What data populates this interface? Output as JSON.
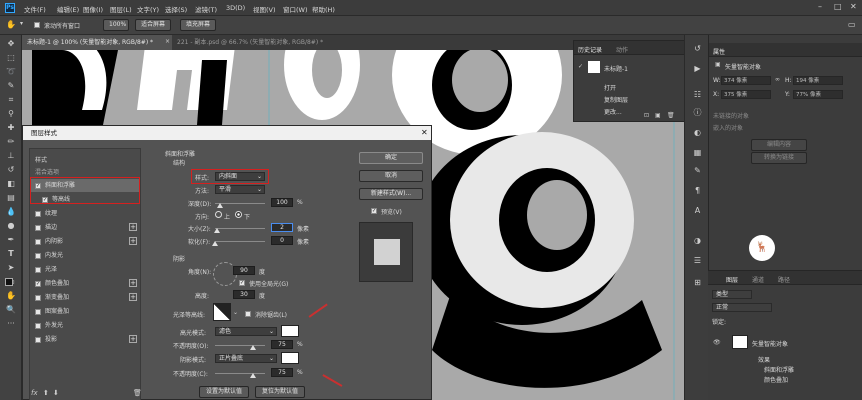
{
  "menubar": {
    "app_icon": "Ps",
    "items": [
      "文件(F)",
      "编辑(E)",
      "图像(I)",
      "图层(L)",
      "文字(Y)",
      "选择(S)",
      "滤镜(T)",
      "3D(D)",
      "视图(V)",
      "窗口(W)",
      "帮助(H)"
    ]
  },
  "options": {
    "scroll_all": "滚动所有窗口",
    "zoom": "100%",
    "fit_screen": "适合屏幕",
    "fill_screen": "填充屏幕"
  },
  "tabs": [
    {
      "label": "未标题-1 @ 100% (矢量智能对象, RGB/8#) *"
    },
    {
      "label": "221 - 副本.psd @ 66.7% (矢量智能对象, RGB/8#) *"
    }
  ],
  "history": {
    "tabs": [
      "历史记录",
      "动作"
    ],
    "snapshot": "未标题-1",
    "items": [
      "打开",
      "复制图层",
      "更改..."
    ]
  },
  "properties": {
    "title": "属性",
    "section": "矢量智能对象",
    "w_label": "W:",
    "w": "374 像素",
    "h_label": "H:",
    "h": "194 像素",
    "x_label": "X:",
    "x": "375 像素",
    "y_label": "Y:",
    "y": "77% 像素",
    "link_label": "未链接的对象",
    "embed_label": "嵌入的对象",
    "edit_btn": "编辑内容",
    "convert_btn": "转换为链接"
  },
  "layers": {
    "tabs": [
      "图层",
      "通道",
      "路径"
    ],
    "kind": "类型",
    "mode": "正常",
    "lock": "锁定:",
    "layer_name": "矢量智能对象",
    "effects": "效果",
    "fx1": "斜面和浮雕",
    "fx2": "颜色叠加"
  },
  "dialog": {
    "title": "图层样式",
    "styles_header": "样式",
    "blend_options": "混合选项",
    "items": [
      {
        "label": "斜面和浮雕",
        "checked": true,
        "plus": false
      },
      {
        "label": "等高线",
        "checked": true,
        "plus": false
      },
      {
        "label": "纹理",
        "checked": false,
        "plus": false
      },
      {
        "label": "描边",
        "checked": false,
        "plus": true
      },
      {
        "label": "内阴影",
        "checked": false,
        "plus": true
      },
      {
        "label": "内发光",
        "checked": false,
        "plus": false
      },
      {
        "label": "光泽",
        "checked": false,
        "plus": false
      },
      {
        "label": "颜色叠加",
        "checked": true,
        "plus": true
      },
      {
        "label": "渐变叠加",
        "checked": false,
        "plus": true
      },
      {
        "label": "图案叠加",
        "checked": false,
        "plus": false
      },
      {
        "label": "外发光",
        "checked": false,
        "plus": false
      },
      {
        "label": "投影",
        "checked": false,
        "plus": true
      }
    ],
    "bevel_title": "斜面和浮雕",
    "structure_title": "结构",
    "style_label": "样式:",
    "style_value": "内斜面",
    "method_label": "方法:",
    "method_value": "平滑",
    "depth_label": "深度(D):",
    "depth_value": "100",
    "depth_unit": "%",
    "depth_level": 0.1,
    "direction_label": "方向:",
    "dir_up": "上",
    "dir_down": "下",
    "size_label": "大小(Z):",
    "size_value": "2",
    "size_unit": "像素",
    "soften_label": "软化(F):",
    "soften_value": "0",
    "soften_unit": "像素",
    "shading_title": "阴影",
    "angle_label": "角度(N):",
    "angle_value": "90",
    "angle_unit": "度",
    "global_light": "使用全局光(G)",
    "altitude_label": "高度:",
    "altitude_value": "30",
    "altitude_unit": "度",
    "gloss_label": "光泽等高线:",
    "antialias": "消除锯齿(L)",
    "highlight_label": "高光模式:",
    "highlight_value": "滤色",
    "hl_opacity_label": "不透明度(O):",
    "hl_opacity_value": "75",
    "hl_opacity_unit": "%",
    "hl_opacity_level": 0.75,
    "shadow_label": "阴影模式:",
    "shadow_value": "正片叠底",
    "sh_opacity_label": "不透明度(C):",
    "sh_opacity_value": "75",
    "sh_opacity_unit": "%",
    "sh_opacity_level": 0.75,
    "set_default": "设置为默认值",
    "reset_default": "复位为默认值",
    "ok": "确定",
    "cancel": "取消",
    "new_style": "新建样式(W)...",
    "preview": "预览(V)"
  },
  "colors": {
    "accent_red": "#d6201f",
    "ps_blue": "#31a8ff"
  }
}
